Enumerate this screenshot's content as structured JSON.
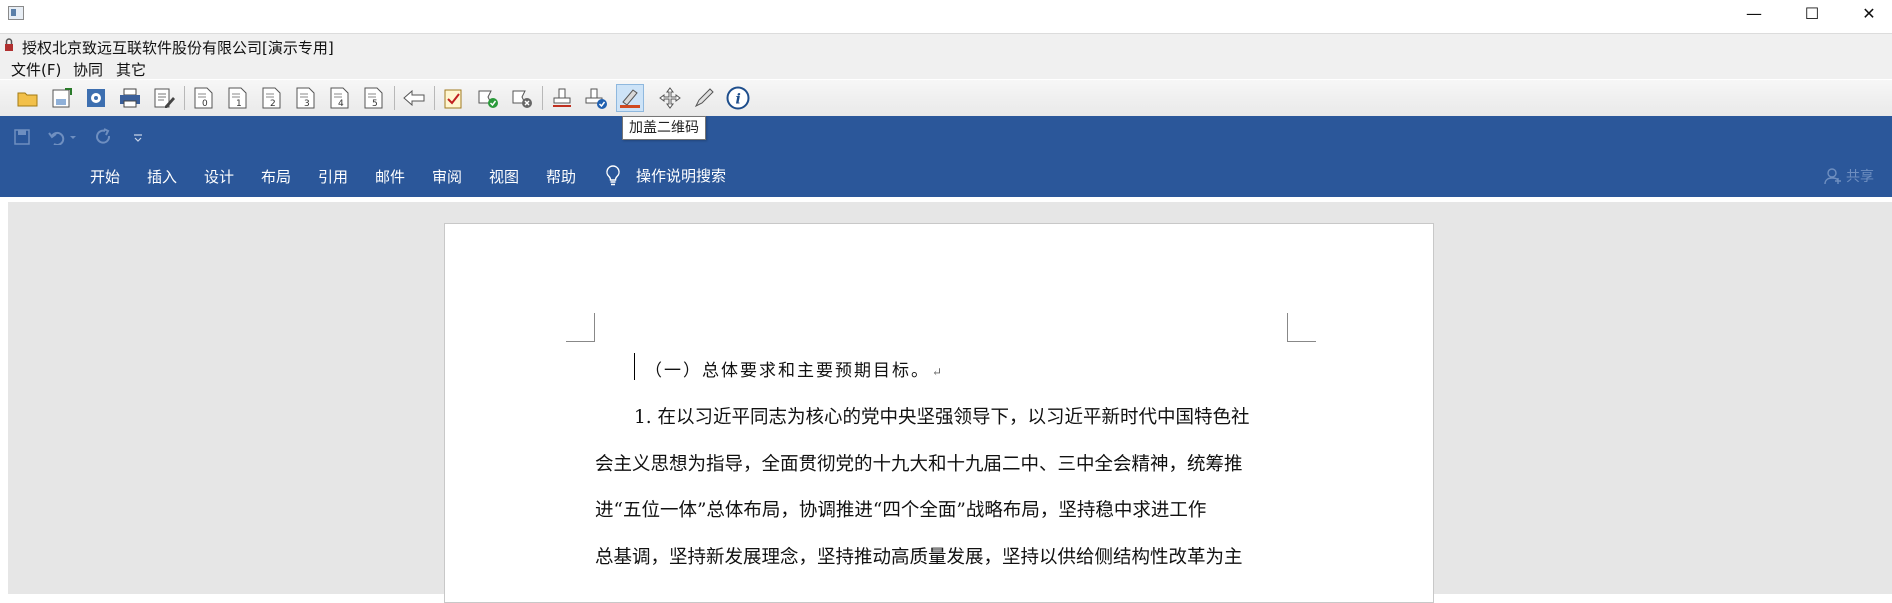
{
  "window": {
    "minimize_glyph": "—",
    "maximize_glyph": "☐",
    "close_glyph": "✕"
  },
  "host": {
    "caption": "授权北京致远互联软件股份有限公司[演示专用]",
    "menu": [
      "文件(F)",
      "协同",
      "其它"
    ],
    "toolbar_icons": [
      "open-folder-icon",
      "upload-save-icon",
      "settings-icon",
      "print-icon",
      "edit-document-icon",
      "doc-0-icon",
      "doc-1-icon",
      "doc-2-icon",
      "doc-3-icon",
      "doc-4-icon",
      "doc-5-icon",
      "back-arrow-icon",
      "approve-doc-icon",
      "sign-ok-icon",
      "sign-cancel-icon",
      "stamp-icon",
      "stamp-check-icon",
      "add-qrcode-stamp-icon",
      "move-icon",
      "pen-icon",
      "info-icon"
    ],
    "tooltip": "加盖二维码"
  },
  "word": {
    "tabs": [
      "开始",
      "插入",
      "设计",
      "布局",
      "引用",
      "邮件",
      "审阅",
      "视图",
      "帮助"
    ],
    "tell_me": "操作说明搜索",
    "share": "共享"
  },
  "document": {
    "heading": "（一）总体要求和主要预期目标。",
    "paragraph_mark": "↵",
    "lines": [
      "1. 在以习近平同志为核心的党中央坚强领导下，以习近平新时代中国特色社",
      "会主义思想为指导，全面贯彻党的十九大和十九届二中、三中全会精神，统筹推",
      "进“五位一体”总体布局，协调推进“四个全面”战略布局，坚持稳中求进工作",
      "总基调，坚持新发展理念，坚持推动高质量发展，坚持以供给侧结构性改革为主"
    ]
  },
  "colors": {
    "ribbon": "#2b579a",
    "canvas": "#e6e6e6",
    "toolbar": "#ececec"
  }
}
